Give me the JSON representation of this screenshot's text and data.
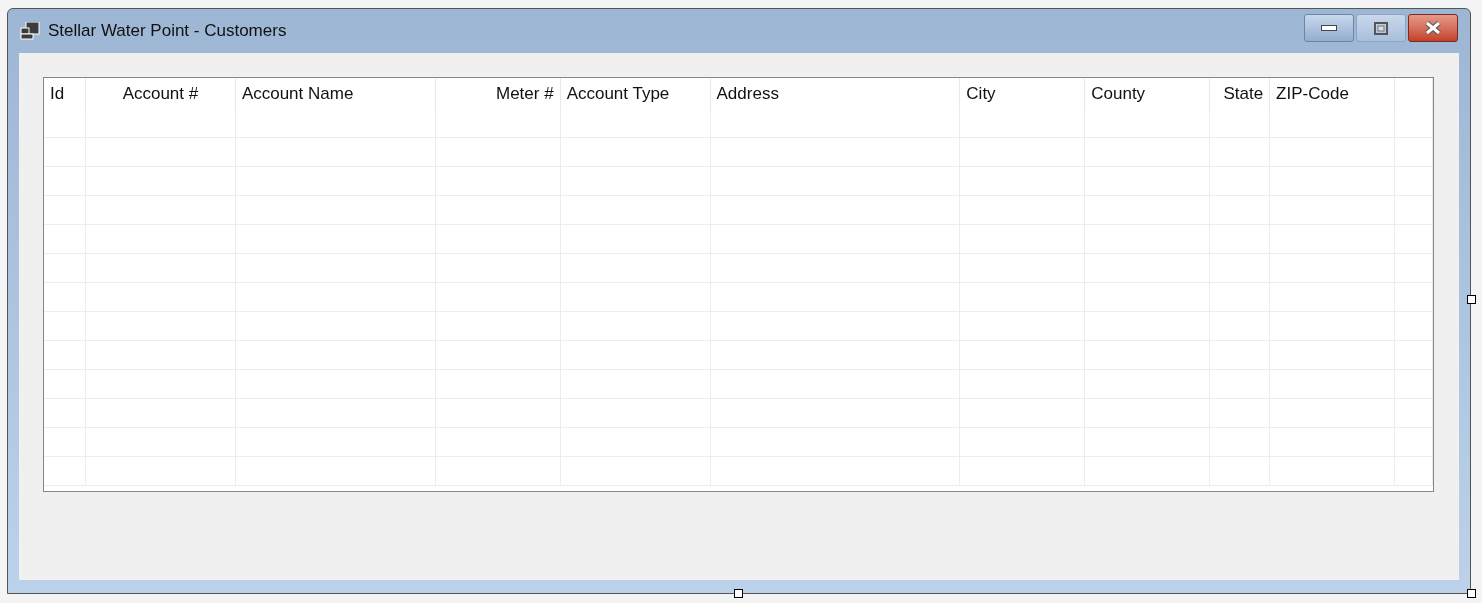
{
  "window": {
    "title": "Stellar Water Point - Customers"
  },
  "list": {
    "columns": [
      {
        "label": "Id"
      },
      {
        "label": "Account #"
      },
      {
        "label": "Account Name"
      },
      {
        "label": "Meter #"
      },
      {
        "label": "Account Type"
      },
      {
        "label": "Address"
      },
      {
        "label": "City"
      },
      {
        "label": "County"
      },
      {
        "label": "State"
      },
      {
        "label": "ZIP-Code"
      }
    ]
  }
}
